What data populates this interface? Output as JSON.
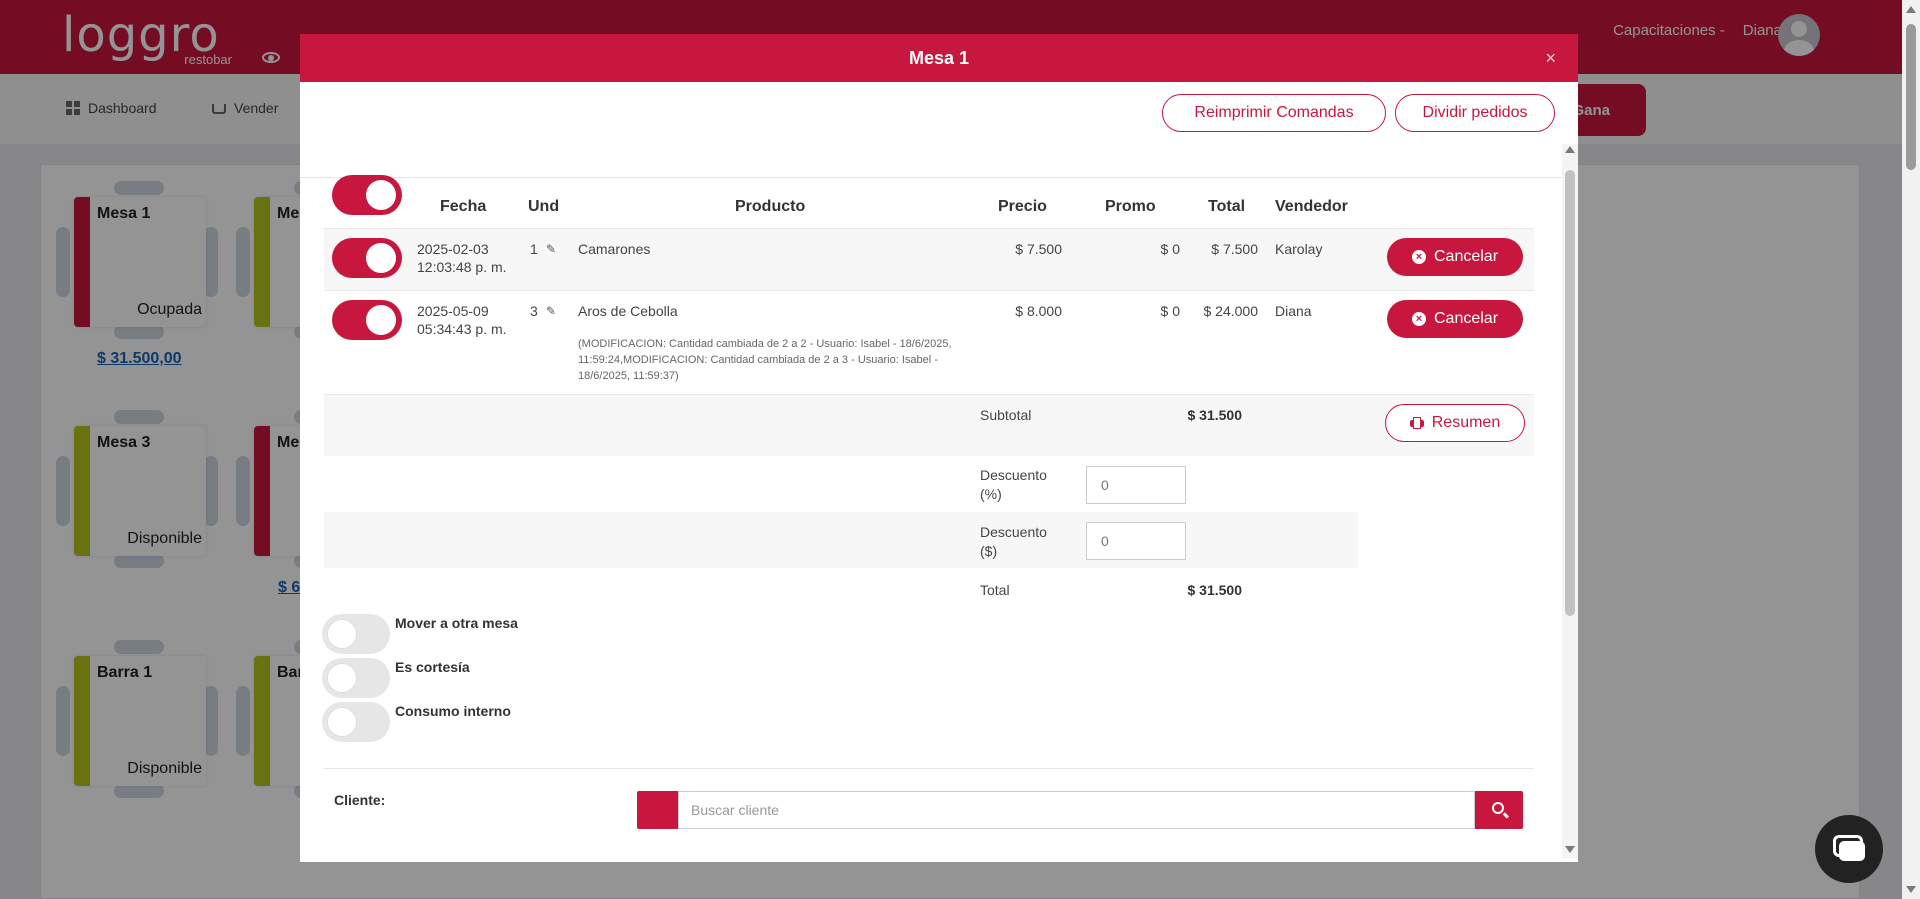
{
  "app": {
    "logo_text": "loggro",
    "logo_sub": "restobar",
    "company": "Capacitaciones -",
    "user": "Diana"
  },
  "nav": {
    "dashboard": "Dashboard",
    "vender": "Vender",
    "gana": "Gana"
  },
  "tables": [
    {
      "name": "Mesa 1",
      "status": "Ocupada",
      "amount": "$ 31.500,00",
      "color": "#c8173f"
    },
    {
      "name": "Me",
      "status": "",
      "amount": "",
      "color": "#b7c31c"
    },
    {
      "name": "Mesa 3",
      "status": "Disponible",
      "amount": "",
      "color": "#b7c31c"
    },
    {
      "name": "Me",
      "status": "",
      "amount": "$ 6",
      "color": "#c8173f"
    },
    {
      "name": "Barra 1",
      "status": "Disponible",
      "amount": "",
      "color": "#b7c31c"
    },
    {
      "name": "Bar",
      "status": "",
      "amount": "",
      "color": "#b7c31c"
    }
  ],
  "modal": {
    "title": "Mesa 1",
    "close": "×",
    "reprint_label": "Reimprimir Comandas",
    "split_label": "Dividir pedidos"
  },
  "columns": {
    "fecha": "Fecha",
    "und": "Und",
    "producto": "Producto",
    "precio": "Precio",
    "promo": "Promo",
    "total": "Total",
    "vendedor": "Vendedor"
  },
  "orders": [
    {
      "date": "2025-02-03",
      "time": "12:03:48 p. m.",
      "qty": "1",
      "product": "Camarones",
      "price": "$ 7.500",
      "promo": "$ 0",
      "total": "$ 7.500",
      "seller": "Karolay",
      "cancel": "Cancelar"
    },
    {
      "date": "2025-05-09",
      "time": "05:34:43 p. m.",
      "qty": "3",
      "product": "Aros de Cebolla",
      "price": "$ 8.000",
      "promo": "$ 0",
      "total": "$ 24.000",
      "seller": "Diana",
      "cancel": "Cancelar",
      "note": "(MODIFICACION: Cantidad cambiada de 2 a 2 - Usuario: Isabel - 18/6/2025, 11:59:24,MODIFICACION: Cantidad cambiada de 2 a 3 - Usuario: Isabel - 18/6/2025, 11:59:37)"
    }
  ],
  "summary": {
    "subtotal_label": "Subtotal",
    "subtotal_value": "$ 31.500",
    "resumen_label": "Resumen",
    "discount_pct_label_1": "Descuento",
    "discount_pct_label_2": "(%)",
    "discount_pct_value": "0",
    "discount_amt_label_1": "Descuento",
    "discount_amt_label_2": "($)",
    "discount_amt_value": "0",
    "total_label": "Total",
    "total_value": "$ 31.500"
  },
  "switches": {
    "move": "Mover a otra mesa",
    "courtesy": "Es cortesía",
    "internal": "Consumo interno"
  },
  "client": {
    "label": "Cliente:",
    "placeholder": "Buscar cliente"
  },
  "icons": {
    "close": "close-icon",
    "edit": "pencil-icon",
    "cancel": "x-circle-icon",
    "print": "printer-icon",
    "search": "search-icon",
    "chat": "chat-icon"
  },
  "colors": {
    "brand": "#c8173f",
    "available": "#b7c31c"
  }
}
